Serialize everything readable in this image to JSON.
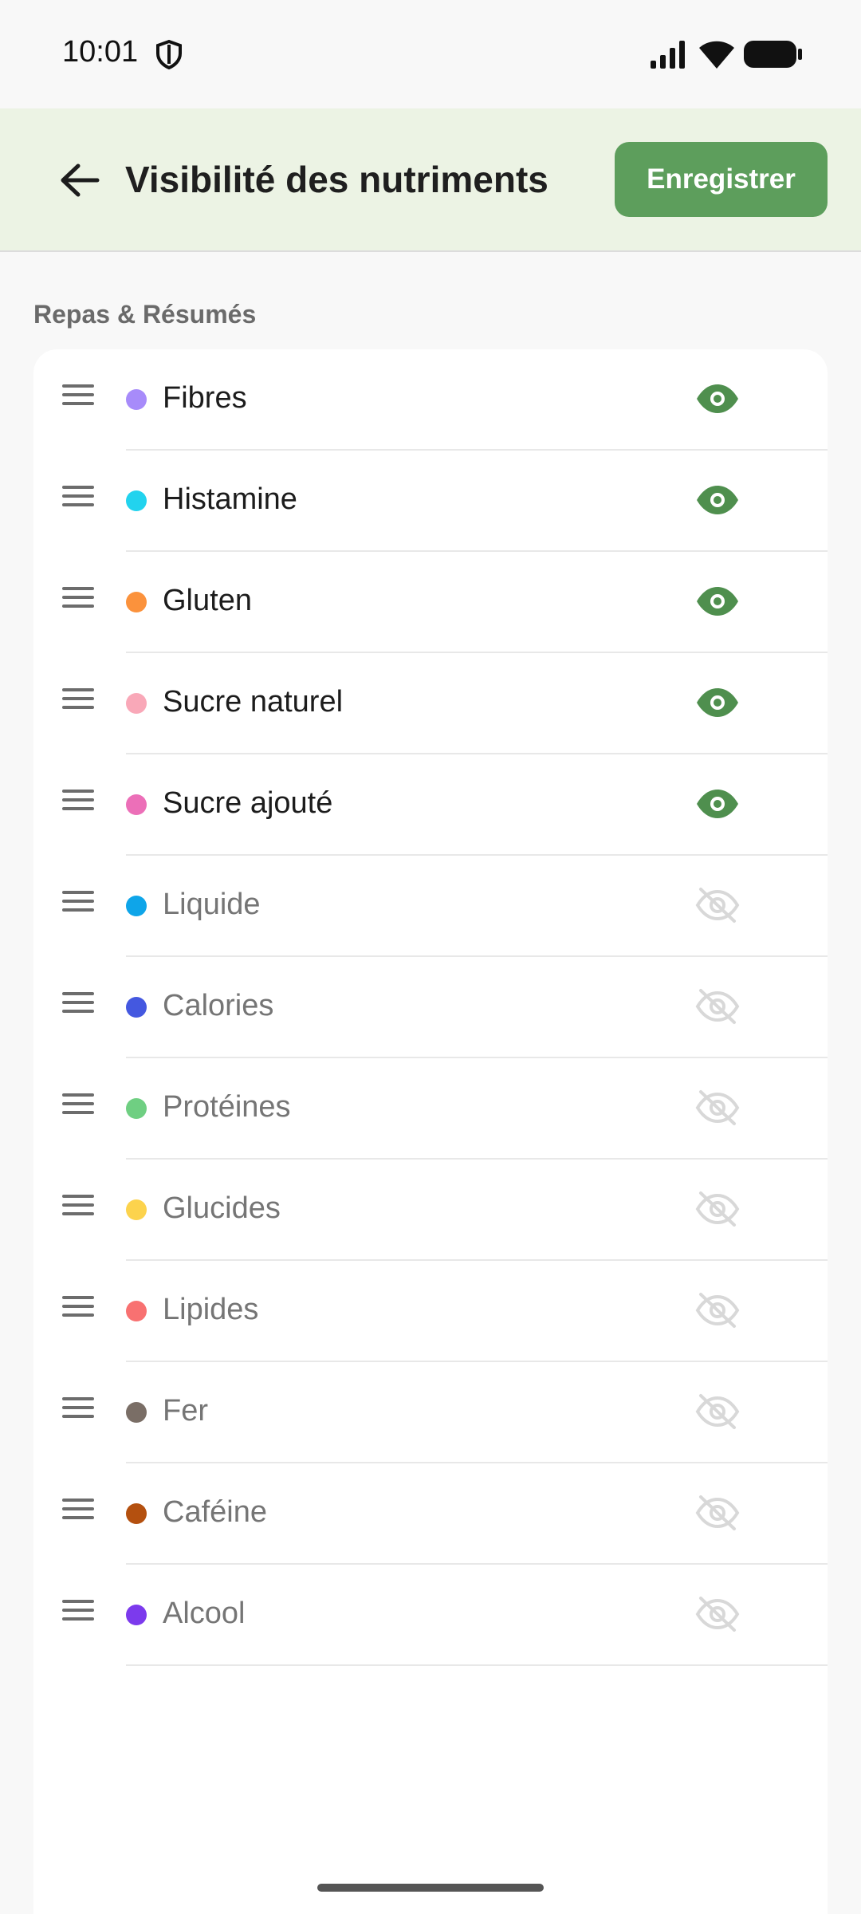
{
  "status_bar": {
    "time": "10:01",
    "icons": [
      "shield-icon",
      "signal-icon",
      "wifi-icon",
      "battery-icon"
    ]
  },
  "app_bar": {
    "back_icon": "arrow-left-icon",
    "title": "Visibilité des nutriments",
    "save_label": "Enregistrer"
  },
  "section": {
    "label": "Repas & Résumés"
  },
  "colors": {
    "accent": "#5d9e5c",
    "eye_visible": "#4f8f4e",
    "eye_hidden": "#d8d8d8"
  },
  "nutrients": [
    {
      "name": "Fibres",
      "color": "#a78bfa",
      "visible": true
    },
    {
      "name": "Histamine",
      "color": "#22d3ee",
      "visible": true
    },
    {
      "name": "Gluten",
      "color": "#fb923c",
      "visible": true
    },
    {
      "name": "Sucre naturel",
      "color": "#f9a8b8",
      "visible": true
    },
    {
      "name": "Sucre ajouté",
      "color": "#ec6fb8",
      "visible": true
    },
    {
      "name": "Liquide",
      "color": "#0ea5e9",
      "visible": false
    },
    {
      "name": "Calories",
      "color": "#4458e0",
      "visible": false
    },
    {
      "name": "Protéines",
      "color": "#6fcf82",
      "visible": false
    },
    {
      "name": "Glucides",
      "color": "#fcd34d",
      "visible": false
    },
    {
      "name": "Lipides",
      "color": "#f87171",
      "visible": false
    },
    {
      "name": "Fer",
      "color": "#7a6e66",
      "visible": false
    },
    {
      "name": "Caféine",
      "color": "#b4500f",
      "visible": false
    },
    {
      "name": "Alcool",
      "color": "#7c3aed",
      "visible": false
    }
  ]
}
